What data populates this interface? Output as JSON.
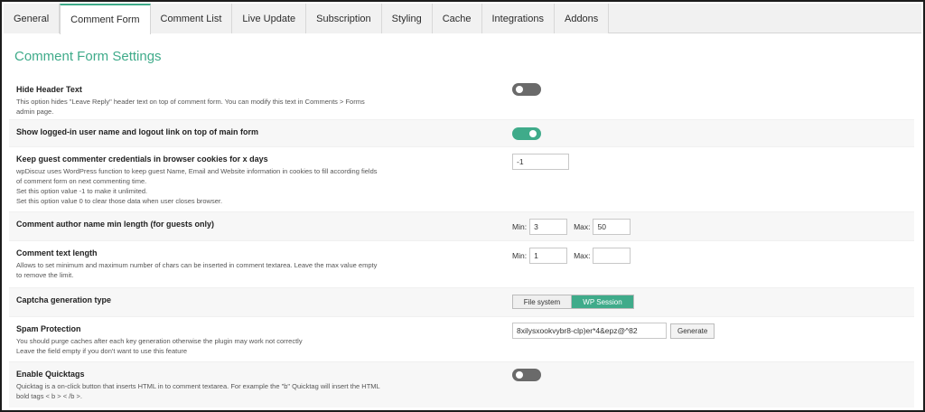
{
  "tabs": [
    {
      "label": "General"
    },
    {
      "label": "Comment Form",
      "active": true
    },
    {
      "label": "Comment List"
    },
    {
      "label": "Live Update"
    },
    {
      "label": "Subscription"
    },
    {
      "label": "Styling"
    },
    {
      "label": "Cache"
    },
    {
      "label": "Integrations"
    },
    {
      "label": "Addons"
    }
  ],
  "page_title": "Comment Form Settings",
  "settings": {
    "hide_header": {
      "label": "Hide Header Text",
      "desc1": "This option hides \"Leave Reply\" header text on top of comment form. You can modify this text in Comments > Forms",
      "desc2": "admin page.",
      "state": "off"
    },
    "show_logged_in": {
      "label": "Show logged-in user name and logout link on top of main form",
      "state": "on"
    },
    "keep_cookies": {
      "label": "Keep guest commenter credentials in browser cookies for x days",
      "desc1": "wpDiscuz uses WordPress function to keep guest Name, Email and Website information in cookies to fill according fields",
      "desc2": "of comment form on next commenting time.",
      "desc3": "Set this option value -1 to make it unlimited.",
      "desc4": "Set this option value 0 to clear those data when user closes browser.",
      "value": "-1"
    },
    "author_name_length": {
      "label": "Comment author name min length (for guests only)",
      "min_label": "Min:",
      "min_value": "3",
      "max_label": "Max:",
      "max_value": "50"
    },
    "text_length": {
      "label": "Comment text length",
      "desc1": "Allows to set minimum and maximum number of chars can be inserted in comment textarea. Leave the max value empty",
      "desc2": "to remove the limit.",
      "min_label": "Min:",
      "min_value": "1",
      "max_label": "Max:",
      "max_value": ""
    },
    "captcha_type": {
      "label": "Captcha generation type",
      "option1": "File system",
      "option2": "WP Session",
      "selected": "WP Session"
    },
    "spam_protection": {
      "label": "Spam Protection",
      "desc1": "You should purge caches after each key generation otherwise the plugin may work not correctly",
      "desc2": "Leave the field empty if you don't want to use this feature",
      "value": "8xilysxookvybr8-clp)er*4&epz@^82",
      "button": "Generate"
    },
    "quicktags": {
      "label": "Enable Quicktags",
      "desc1": "Quicktag is a on-click button that inserts HTML in to comment textarea. For example the \"b\" Quicktag will insert the HTML",
      "desc2": "bold tags < b > < /b >.",
      "state": "off"
    }
  },
  "colors": {
    "accent": "#3fab8a",
    "toggle_off": "#6a6a6a"
  }
}
